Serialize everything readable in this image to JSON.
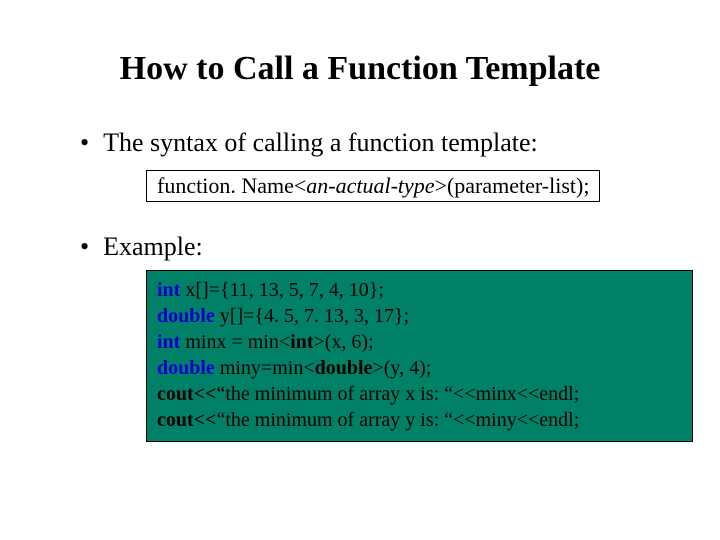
{
  "title": "How to Call a Function Template",
  "bullet1": "The syntax of calling a function template:",
  "syntax": {
    "part1": "function. Name<",
    "part2": "an-actual-type",
    "part3": ">(parameter-list);"
  },
  "bullet2": "Example:",
  "code": {
    "l1a": "int",
    "l1b": " x[]={11, 13, 5, 7, 4, 10};",
    "l2a": "double",
    "l2b": " y[]={4. 5, 7. 13, 3, 17};",
    "l3a": "int",
    "l3b": " minx = min<",
    "l3c": "int",
    "l3d": ">(x, 6);",
    "l4a": "double",
    "l4b": " miny=min<",
    "l4c": "double",
    "l4d": ">(y, 4);",
    "l5a": "cout<<",
    "l5b": "“the minimum of array x is: “<<minx<<endl;",
    "l6a": "cout<<",
    "l6b": "“the minimum of array y is: “<<miny<<endl;"
  }
}
